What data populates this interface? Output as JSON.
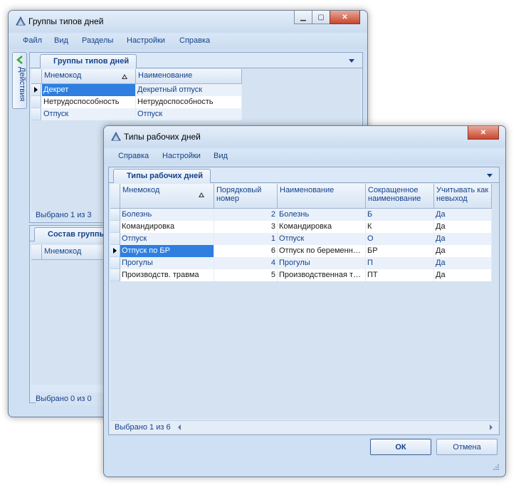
{
  "back_window": {
    "title": "Группы типов дней",
    "menu": [
      "Файл",
      "Вид",
      "Разделы",
      "Настройки",
      "Справка"
    ],
    "side_tab": "Действия",
    "tab_groups": "Группы типов дней",
    "columns": [
      "Мнемокод",
      "Наименование"
    ],
    "rows": [
      {
        "code": "Декрет",
        "name": "Декретный отпуск"
      },
      {
        "code": "Нетрудоспособность",
        "name": "Нетрудоспособность"
      },
      {
        "code": "Отпуск",
        "name": "Отпуск"
      }
    ],
    "status_top": "Выбрано 1 из 3",
    "tab_composition": "Состав группы",
    "composition_column": "Мнемокод",
    "status_bottom": "Выбрано 0 из 0"
  },
  "front_window": {
    "title": "Типы рабочих дней",
    "menu": [
      "Справка",
      "Настройки",
      "Вид"
    ],
    "tab": "Типы рабочих дней",
    "columns": [
      "Мнемокод",
      "Порядковый номер",
      "Наименование",
      "Сокращенное наименование",
      "Учитывать как невыход"
    ],
    "rows": [
      {
        "code": "Болезнь",
        "order": "2",
        "name": "Болезнь",
        "short": "Б",
        "absence": "Да"
      },
      {
        "code": "Командировка",
        "order": "3",
        "name": "Командировка",
        "short": "К",
        "absence": "Да"
      },
      {
        "code": "Отпуск",
        "order": "1",
        "name": "Отпуск",
        "short": "О",
        "absence": "Да"
      },
      {
        "code": "Отпуск по БР",
        "order": "6",
        "name": "Отпуск по беременн…",
        "short": "БР",
        "absence": "Да"
      },
      {
        "code": "Прогулы",
        "order": "4",
        "name": "Прогулы",
        "short": "П",
        "absence": "Да"
      },
      {
        "code": "Производств. травма",
        "order": "5",
        "name": "Производственная т…",
        "short": "ПТ",
        "absence": "Да"
      }
    ],
    "status": "Выбрано 1 из 6",
    "ok_label": "ОК",
    "cancel_label": "Отмена"
  }
}
